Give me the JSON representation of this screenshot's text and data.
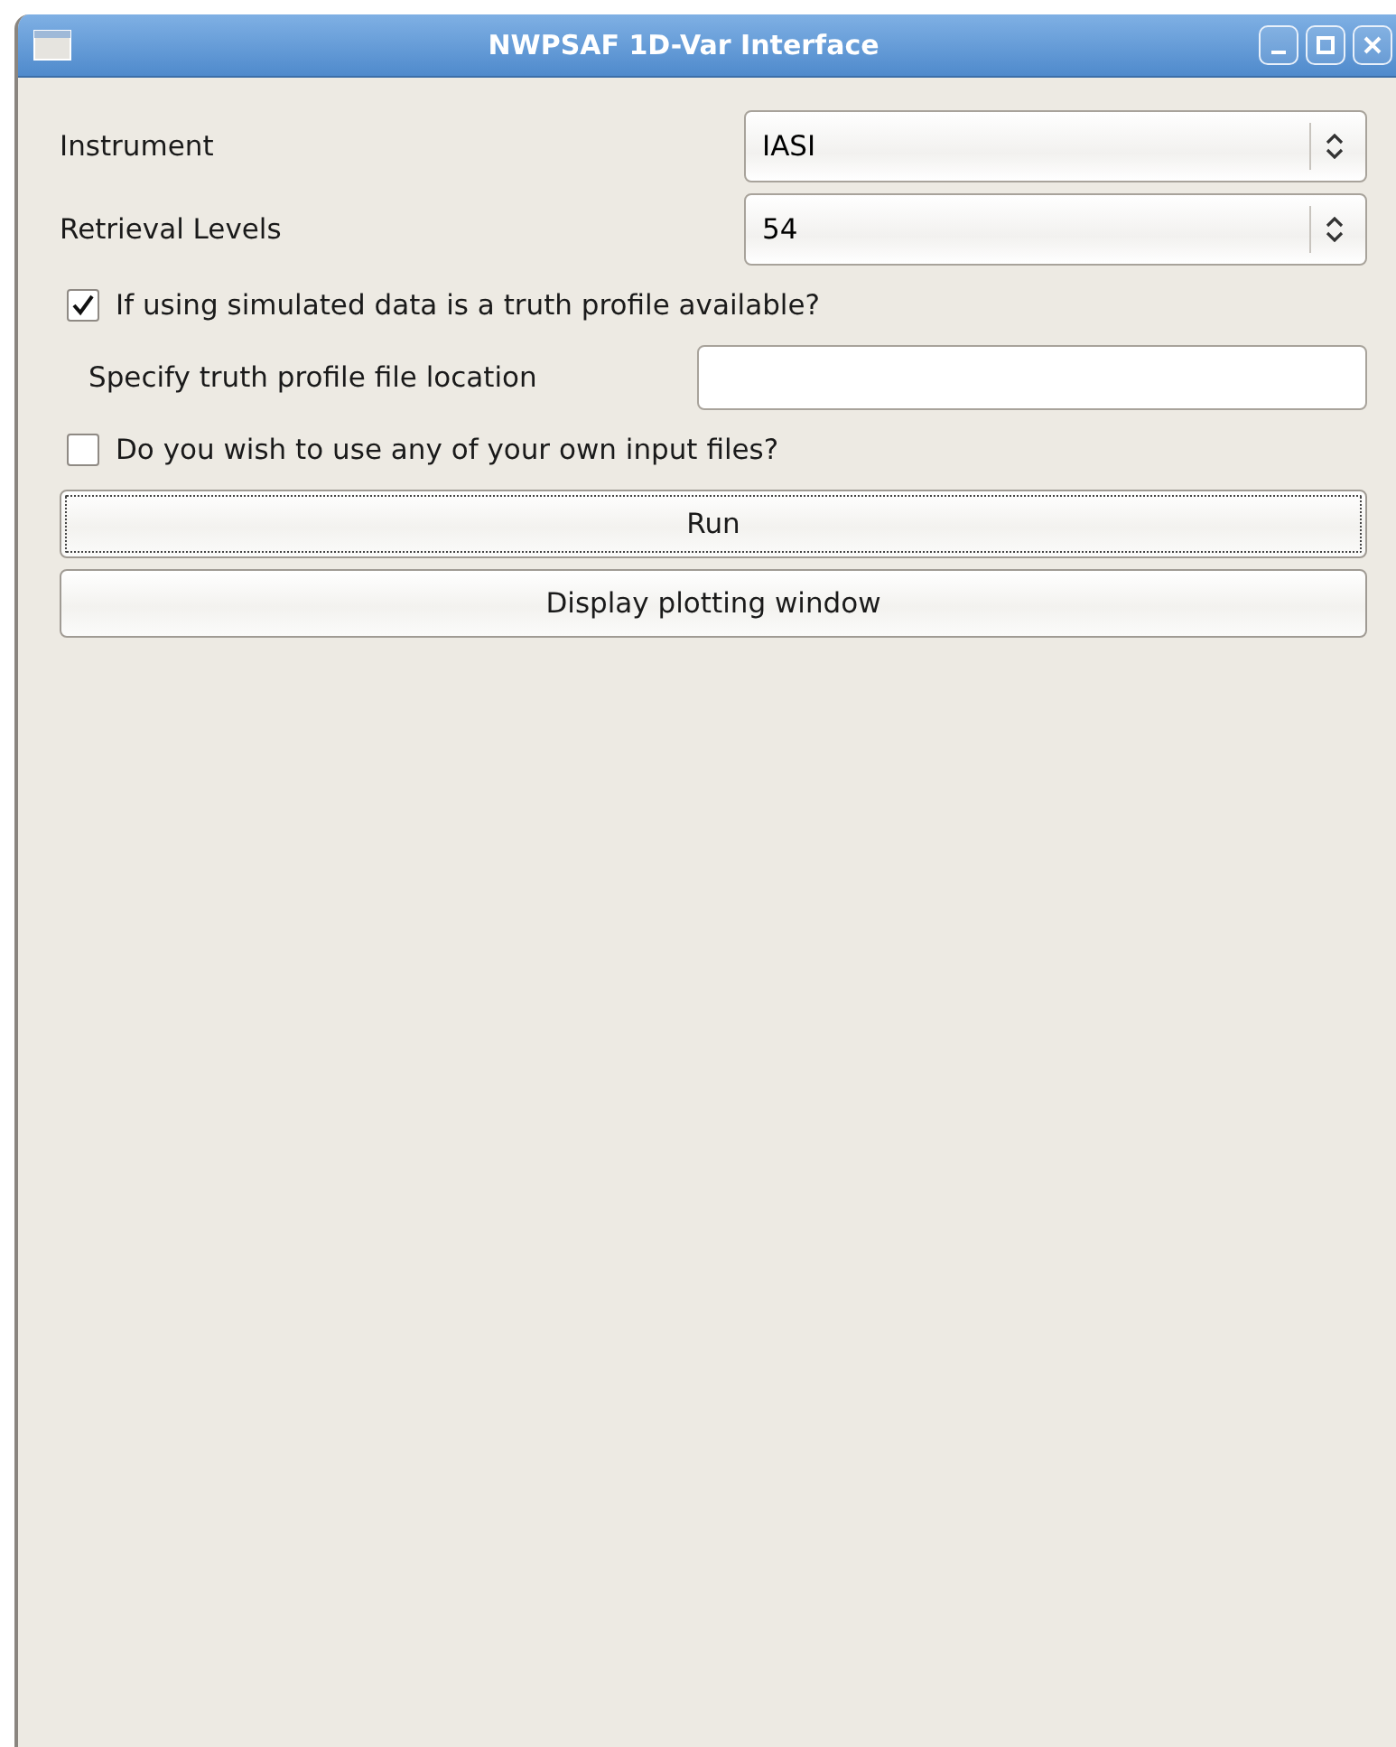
{
  "window": {
    "title": "NWPSAF 1D-Var Interface"
  },
  "rows": [
    {
      "kind": "combo",
      "label": "Instrument",
      "value": "IASI"
    },
    {
      "kind": "combo",
      "label": "Retrieval Levels",
      "value": "54"
    },
    {
      "kind": "checkbox",
      "label": "If using simulated data is a truth profile available?",
      "checked": true
    },
    {
      "kind": "field",
      "label": "Specify truth profile file location"
    },
    {
      "kind": "checkbox",
      "label": "Do you wish to use any of your own input files?",
      "checked": false
    },
    {
      "kind": "button",
      "label": "Run",
      "focused": true
    },
    {
      "kind": "button",
      "label": "Display plotting window",
      "focused": false
    }
  ]
}
